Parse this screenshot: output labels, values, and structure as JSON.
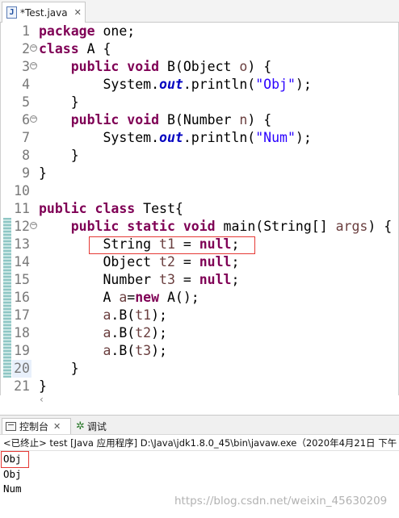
{
  "tab": {
    "title": "*Test.java",
    "icon": "java-file-icon",
    "close": "✕"
  },
  "code_lines": [
    {
      "n": "1",
      "fold": "",
      "parts": [
        [
          "kw",
          "package"
        ],
        [
          "",
          " one;"
        ]
      ]
    },
    {
      "n": "2",
      "fold": "−",
      "parts": [
        [
          "kw",
          "class"
        ],
        [
          "",
          " A {"
        ]
      ]
    },
    {
      "n": "3",
      "fold": "−",
      "parts": [
        [
          "",
          "    "
        ],
        [
          "kw",
          "public"
        ],
        [
          "",
          " "
        ],
        [
          "kw",
          "void"
        ],
        [
          "",
          " B(Object "
        ],
        [
          "var",
          "o"
        ],
        [
          "",
          ") {"
        ]
      ]
    },
    {
      "n": "4",
      "fold": "",
      "parts": [
        [
          "",
          "        System."
        ],
        [
          "fld",
          "out"
        ],
        [
          "",
          ".println("
        ],
        [
          "str",
          "\"Obj\""
        ],
        [
          "",
          ");"
        ]
      ]
    },
    {
      "n": "5",
      "fold": "",
      "parts": [
        [
          "",
          "    }"
        ]
      ]
    },
    {
      "n": "6",
      "fold": "−",
      "parts": [
        [
          "",
          "    "
        ],
        [
          "kw",
          "public"
        ],
        [
          "",
          " "
        ],
        [
          "kw",
          "void"
        ],
        [
          "",
          " B(Number "
        ],
        [
          "var",
          "n"
        ],
        [
          "",
          ") {"
        ]
      ]
    },
    {
      "n": "7",
      "fold": "",
      "parts": [
        [
          "",
          "        System."
        ],
        [
          "fld",
          "out"
        ],
        [
          "",
          ".println("
        ],
        [
          "str",
          "\"Num\""
        ],
        [
          "",
          ");"
        ]
      ]
    },
    {
      "n": "8",
      "fold": "",
      "parts": [
        [
          "",
          "    }"
        ]
      ]
    },
    {
      "n": "9",
      "fold": "",
      "parts": [
        [
          "",
          "}"
        ]
      ]
    },
    {
      "n": "10",
      "fold": "",
      "parts": []
    },
    {
      "n": "11",
      "fold": "",
      "parts": [
        [
          "kw",
          "public"
        ],
        [
          "",
          " "
        ],
        [
          "kw",
          "class"
        ],
        [
          "",
          " Test{"
        ]
      ]
    },
    {
      "n": "12",
      "fold": "−",
      "parts": [
        [
          "",
          "    "
        ],
        [
          "kw",
          "public"
        ],
        [
          "",
          " "
        ],
        [
          "kw",
          "static"
        ],
        [
          "",
          " "
        ],
        [
          "kw",
          "void"
        ],
        [
          "",
          " main(String[] "
        ],
        [
          "var",
          "args"
        ],
        [
          "",
          ") {"
        ]
      ]
    },
    {
      "n": "13",
      "fold": "",
      "parts": [
        [
          "",
          "        String "
        ],
        [
          "var",
          "t1"
        ],
        [
          "",
          " = "
        ],
        [
          "kw",
          "null"
        ],
        [
          "",
          ";"
        ]
      ]
    },
    {
      "n": "14",
      "fold": "",
      "parts": [
        [
          "",
          "        Object "
        ],
        [
          "var",
          "t2"
        ],
        [
          "",
          " = "
        ],
        [
          "kw",
          "null"
        ],
        [
          "",
          ";"
        ]
      ]
    },
    {
      "n": "15",
      "fold": "",
      "parts": [
        [
          "",
          "        Number "
        ],
        [
          "var",
          "t3"
        ],
        [
          "",
          " = "
        ],
        [
          "kw",
          "null"
        ],
        [
          "",
          ";"
        ]
      ]
    },
    {
      "n": "16",
      "fold": "",
      "parts": [
        [
          "",
          "        A "
        ],
        [
          "var",
          "a"
        ],
        [
          "",
          "="
        ],
        [
          "kw",
          "new"
        ],
        [
          "",
          " A();"
        ]
      ]
    },
    {
      "n": "17",
      "fold": "",
      "parts": [
        [
          "",
          "        "
        ],
        [
          "var",
          "a"
        ],
        [
          "",
          ".B("
        ],
        [
          "var",
          "t1"
        ],
        [
          "",
          ");"
        ]
      ]
    },
    {
      "n": "18",
      "fold": "",
      "parts": [
        [
          "",
          "        "
        ],
        [
          "var",
          "a"
        ],
        [
          "",
          ".B("
        ],
        [
          "var",
          "t2"
        ],
        [
          "",
          ");"
        ]
      ]
    },
    {
      "n": "19",
      "fold": "",
      "parts": [
        [
          "",
          "        "
        ],
        [
          "var",
          "a"
        ],
        [
          "",
          ".B("
        ],
        [
          "var",
          "t3"
        ],
        [
          "",
          ");"
        ]
      ]
    },
    {
      "n": "20",
      "fold": "",
      "parts": [
        [
          "",
          "    }"
        ]
      ]
    },
    {
      "n": "21",
      "fold": "",
      "parts": [
        [
          "",
          "}"
        ]
      ]
    }
  ],
  "console": {
    "tab_console": "控制台",
    "tab_debug": "调试",
    "close": "✕",
    "terminated_line": "<已终止> test [Java 应用程序] D:\\Java\\jdk1.8.0_45\\bin\\javaw.exe（2020年4月21日 下午",
    "output": [
      "Obj",
      "Obj",
      "Num"
    ]
  },
  "scroll_left_arrow": "‹",
  "watermark": "https://blog.csdn.net/weixin_45630209",
  "colors": {
    "keyword": "#7f0055",
    "string": "#2a00ff",
    "field": "#0000c0",
    "local_var": "#6a3e3e",
    "highlight": "#e53935"
  }
}
